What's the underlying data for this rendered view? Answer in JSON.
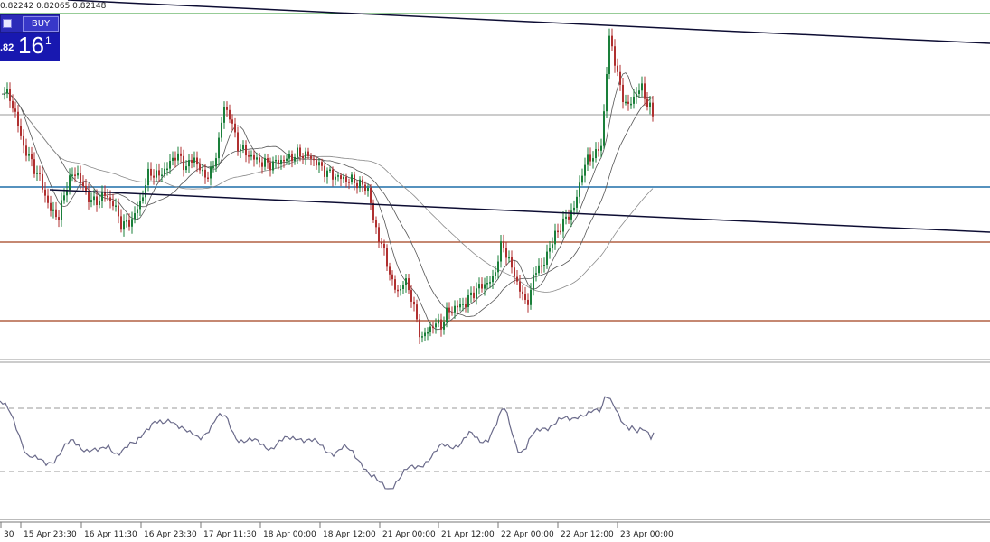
{
  "ohlc": {
    "values_text": "0.82242 0.82065 0.82148"
  },
  "trade_panel": {
    "buy_label": "BUY",
    "price_small": ".82",
    "price_big": "16",
    "price_sup": "1"
  },
  "colors": {
    "background": "#ffffff",
    "bull_candle": "#1a7f3a",
    "bear_candle": "#b03030",
    "ma_line": "#555555",
    "trend_line": "#0d0d33",
    "support_blue": "#1f6fa8",
    "resistance_red": "#a2411e",
    "top_green": "#2f9a2f",
    "gray_level": "#9a9a9a",
    "rsi_line": "#6a6a8a",
    "rsi_level": "#9a9a9a",
    "axis": "#777777",
    "panel_blue": "#1818b0"
  },
  "axis_labels": [
    "30",
    "15 Apr 23:30",
    "16 Apr 11:30",
    "16 Apr 23:30",
    "17 Apr 11:30",
    "18 Apr 00:00",
    "18 Apr 12:00",
    "21 Apr 00:00",
    "21 Apr 12:00",
    "22 Apr 00:00",
    "22 Apr 12:00",
    "23 Apr 00:00"
  ]
}
